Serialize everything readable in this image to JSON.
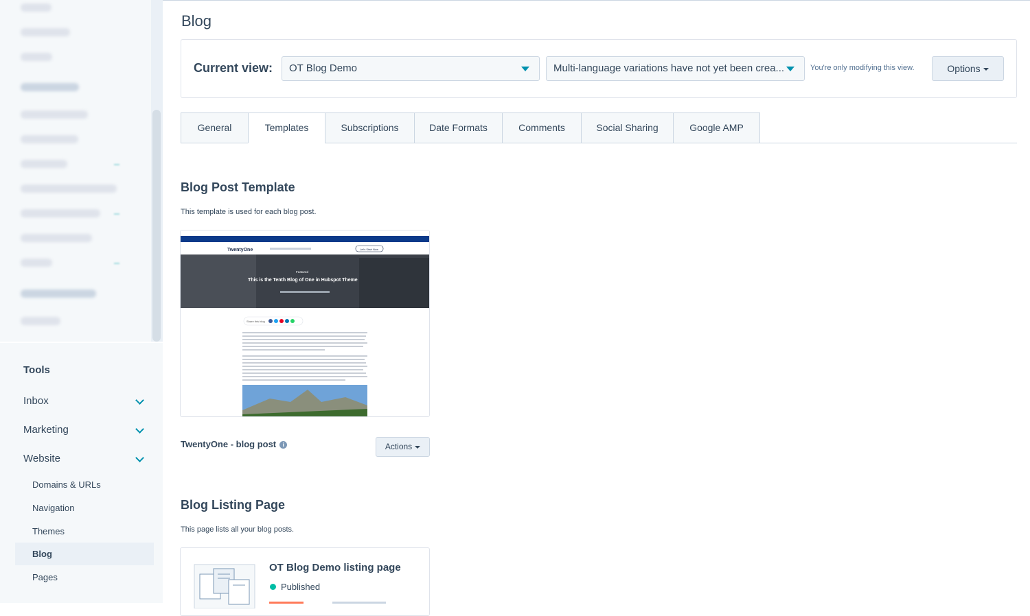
{
  "sidebar": {
    "tools_title": "Tools",
    "groups": [
      {
        "label": "Inbox"
      },
      {
        "label": "Marketing"
      },
      {
        "label": "Website"
      }
    ],
    "website_items": [
      {
        "label": "Domains & URLs"
      },
      {
        "label": "Navigation"
      },
      {
        "label": "Themes"
      },
      {
        "label": "Blog",
        "active": true
      },
      {
        "label": "Pages"
      }
    ]
  },
  "page": {
    "title": "Blog"
  },
  "view_bar": {
    "label": "Current view:",
    "blog_select": "OT Blog Demo",
    "language_select": "Multi-language variations have not yet been crea...",
    "hint": "You're only modifying this view.",
    "options_label": "Options"
  },
  "tabs": [
    {
      "label": "General"
    },
    {
      "label": "Templates",
      "active": true
    },
    {
      "label": "Subscriptions"
    },
    {
      "label": "Date Formats"
    },
    {
      "label": "Comments"
    },
    {
      "label": "Social Sharing"
    },
    {
      "label": "Google AMP"
    }
  ],
  "blog_post_template": {
    "title": "Blog Post Template",
    "description": "This template is used for each blog post.",
    "template_name": "TwentyOne - blog post",
    "actions_label": "Actions",
    "preview": {
      "hero_title": "This is the Tenth Blog of One in Hubspot Theme",
      "hero_sub": "Featured",
      "logo_text": "TwentyOne",
      "share_label": "Share this blog",
      "cta": "Let's Start Now"
    }
  },
  "blog_listing": {
    "title": "Blog Listing Page",
    "description": "This page lists all your blog posts.",
    "page_name": "OT Blog Demo listing page",
    "status": "Published"
  },
  "colors": {
    "accent": "#0091ae",
    "text": "#33475b",
    "published": "#00bda5",
    "primary_button": "#ff7a59"
  }
}
